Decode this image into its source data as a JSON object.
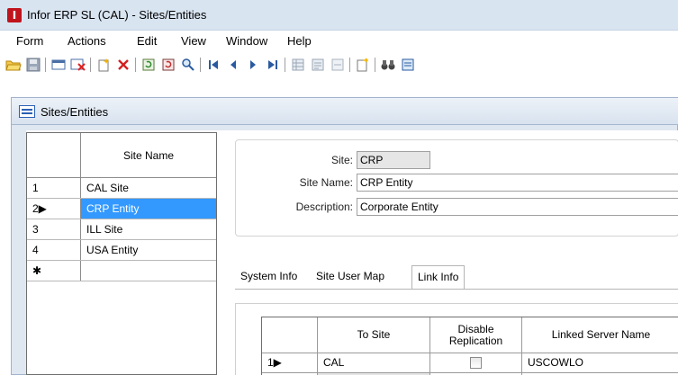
{
  "window": {
    "title": "Infor ERP SL (CAL) - Sites/Entities",
    "app_icon_glyph": "I"
  },
  "menu": [
    "Form",
    "Actions",
    "Edit",
    "View",
    "Window",
    "Help"
  ],
  "form": {
    "title": "Sites/Entities",
    "left_grid": {
      "header": "Site Name",
      "rows": [
        {
          "num": "1",
          "value": "CAL Site"
        },
        {
          "num": "2▶",
          "value": "CRP Entity"
        },
        {
          "num": "3",
          "value": "ILL Site"
        },
        {
          "num": "4",
          "value": "USA Entity"
        },
        {
          "num": "✱",
          "value": ""
        }
      ]
    },
    "fields": {
      "site_label": "Site:",
      "site_value": "CRP",
      "site_name_label": "Site Name:",
      "site_name_value": "CRP Entity",
      "description_label": "Description:",
      "description_value": "Corporate Entity"
    },
    "tabs": [
      {
        "label": "System Info"
      },
      {
        "label": "Site User Map"
      },
      {
        "label": "Link Info"
      }
    ],
    "link_grid": {
      "headers": [
        "To Site",
        "Disable Replication",
        "Linked Server Name"
      ],
      "rows": [
        {
          "num": "1▶",
          "to_site": "CAL",
          "linked_server": "USCOWLO"
        },
        {
          "num": "✱",
          "to_site": "",
          "linked_server": ""
        }
      ]
    }
  }
}
